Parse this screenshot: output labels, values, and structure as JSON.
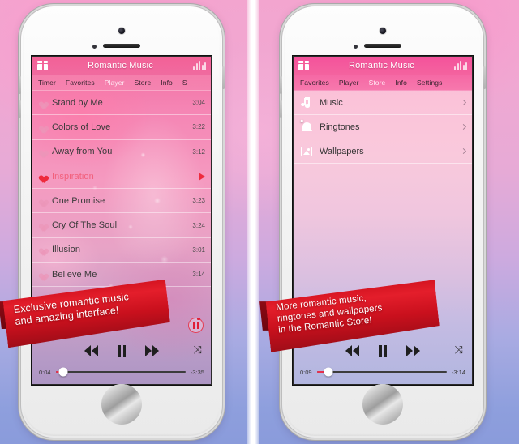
{
  "app": {
    "title": "Romantic Music",
    "gift_icon": "gift-icon",
    "equalizer_icon": "equalizer-icon"
  },
  "left_phone": {
    "tabs": [
      {
        "label": "Timer",
        "active": false
      },
      {
        "label": "Favorites",
        "active": false
      },
      {
        "label": "Player",
        "active": true
      },
      {
        "label": "Store",
        "active": false
      },
      {
        "label": "Info",
        "active": false
      },
      {
        "label": "S",
        "active": false
      }
    ],
    "songs": [
      {
        "title": "Stand by Me",
        "time": "3:04",
        "active": false
      },
      {
        "title": "Colors of Love",
        "time": "3:22",
        "active": false
      },
      {
        "title": "Away from You",
        "time": "3:12",
        "active": false
      },
      {
        "title": "Inspiration",
        "time": "",
        "active": true
      },
      {
        "title": "One Promise",
        "time": "3:23",
        "active": false
      },
      {
        "title": "Cry Of The Soul",
        "time": "3:24",
        "active": false
      },
      {
        "title": "Illusion",
        "time": "3:01",
        "active": false
      },
      {
        "title": "Believe Me",
        "time": "3:14",
        "active": false
      }
    ],
    "player": {
      "elapsed": "0:04",
      "remaining": "-3:35",
      "prev_icon": "previous-track-icon",
      "pause_icon": "pause-icon",
      "next_icon": "next-track-icon",
      "shuffle_icon": "shuffle-icon",
      "record_icon": "record-pause-icon"
    },
    "ribbon": {
      "line1": "Exclusive romantic music",
      "line2": "and amazing interface!"
    }
  },
  "right_phone": {
    "tabs": [
      {
        "label": "Favorites",
        "active": false
      },
      {
        "label": "Player",
        "active": false
      },
      {
        "label": "Store",
        "active": true
      },
      {
        "label": "Info",
        "active": false
      },
      {
        "label": "Settings",
        "active": false
      }
    ],
    "store_items": [
      {
        "label": "Music",
        "icon": "music-note-icon"
      },
      {
        "label": "Ringtones",
        "icon": "bell-icon"
      },
      {
        "label": "Wallpapers",
        "icon": "image-icon"
      }
    ],
    "player": {
      "elapsed": "0:09",
      "remaining": "-3:14",
      "prev_icon": "previous-track-icon",
      "pause_icon": "pause-icon",
      "next_icon": "next-track-icon",
      "shuffle_icon": "shuffle-icon"
    },
    "ribbon": {
      "line1": "More romantic music,",
      "line2": "ringtones and wallpapers",
      "line3": "in the Romantic Store!"
    }
  },
  "colors": {
    "accent_pink": "#f4609a",
    "accent_red": "#e41e2b",
    "ribbon_red": "#d51421",
    "active_song": "#f2607c",
    "heart_red": "#ee2b3d"
  },
  "symbols": {
    "shuffle": "⤨"
  }
}
